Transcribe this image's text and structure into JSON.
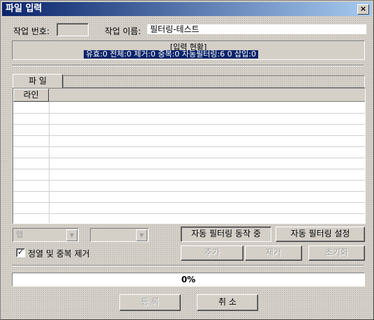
{
  "window": {
    "title": "파일 입력",
    "close_glyph": "×"
  },
  "job": {
    "number_label": "작업 번호:",
    "number_value": "",
    "name_label": "작업 이름:",
    "name_value": "필터링-테스트"
  },
  "status": {
    "title": "[입력 현황]",
    "line": "유효:0  전체:0  제거:0  중복:0  자동필터링:6   0 삽입:0"
  },
  "tabs": [
    {
      "label": "파  일"
    }
  ],
  "grid": {
    "columns": [
      "라인",
      ""
    ],
    "rows": 11
  },
  "controls": {
    "tab_combo": "탭",
    "second_combo": "",
    "auto_filter_running": "자동 필터링 동작 중",
    "auto_filter_settings": "자동 필터링 설정",
    "sort_dedupe_checkbox": {
      "label": "정열 및 중복 제거",
      "checked": true
    },
    "add": "추가",
    "remove": "제거",
    "reset": "초기화"
  },
  "progress": {
    "percent": 0,
    "text": "0%"
  },
  "footer": {
    "register": "등 록",
    "cancel": "취 소"
  }
}
